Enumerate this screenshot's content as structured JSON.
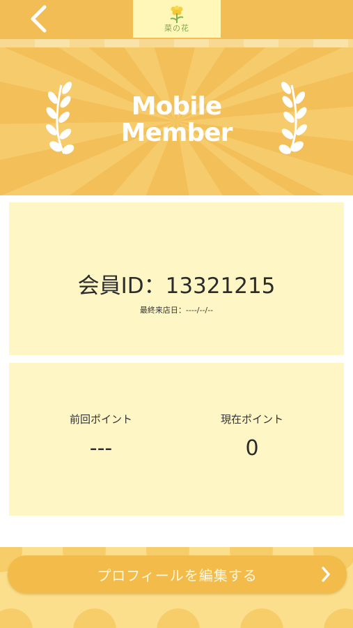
{
  "header": {
    "back_icon": "chevron-left-icon",
    "logo_text": "菜の花",
    "logo_icon": "rapeseed-flower-icon"
  },
  "hero": {
    "title_line1": "Mobile",
    "title_line2": "Member",
    "left_icon": "laurel-branch-icon",
    "right_icon": "laurel-branch-icon"
  },
  "member_card": {
    "id_text": "会員ID：13321215",
    "last_visit": "最終来店日：----/--/--"
  },
  "points_card": {
    "previous_label": "前回ポイント",
    "previous_value": "---",
    "current_label": "現在ポイント",
    "current_value": "0"
  },
  "footer": {
    "profile_button_label": "プロフィールを編集する",
    "chevron_icon": "chevron-right-icon"
  },
  "colors": {
    "accent": "#f3bf58",
    "card": "#fff6c6",
    "footer": "#fbdf8c"
  }
}
